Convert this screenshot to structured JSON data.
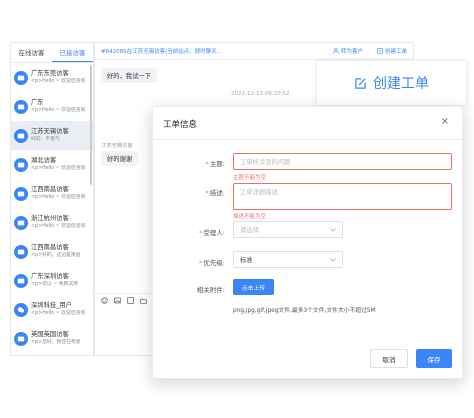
{
  "sidebar": {
    "tabs": [
      "在线访客",
      "已接访客"
    ],
    "items": [
      {
        "name": "广东东莞访客",
        "msg": "<p>Hello ~ 欢迎您咨询"
      },
      {
        "name": "广东",
        "msg": "<p>Hello ~ 欢迎您咨询"
      },
      {
        "name": "江苏无锡访客",
        "msg": "好的，不客气"
      },
      {
        "name": "湖北访客",
        "msg": "<p>Hello ~ 欢迎您咨询"
      },
      {
        "name": "江西南昌访客",
        "msg": "<p>Hello ~ 欢迎您咨询"
      },
      {
        "name": "浙江杭州访客",
        "msg": "<p>Hello ~ 欢迎您咨询"
      },
      {
        "name": "江西南昌访客",
        "msg": "<p>好的，这边是南昌"
      },
      {
        "name": "广东深圳访客",
        "msg": "<p>可以 ~ 免费试用"
      },
      {
        "name": "深圳科技_用户",
        "msg": "<p>Hello ~ 欢迎您咨询"
      },
      {
        "name": "英国英国访客",
        "msg": "<p>您好，我还在考虑"
      }
    ]
  },
  "chat": {
    "title": "#642085在江苏无锡访客(当前站点：即时聊天...",
    "transfer_label": "转为客户",
    "ticket_label": "创建工单",
    "bubble1": "好的，我试一下",
    "timestamp": "2022-12-13 09:20:52",
    "from": "江苏无锡访客",
    "bubble2": "好的谢谢"
  },
  "create_card": {
    "label": "创建工单"
  },
  "modal": {
    "title": "工单信息",
    "close": "×",
    "subject_label": "主题:",
    "subject_placeholder": "工单所涉及的问题",
    "subject_error": "主题不能为空",
    "desc_label": "描述:",
    "desc_placeholder": "工单详细描述",
    "desc_error": "描述不能为空",
    "assignee_label": "受理人:",
    "assignee_placeholder": "请选择",
    "priority_label": "优先级:",
    "priority_value": "标准",
    "attach_label": "相关附件:",
    "upload_label": "点击上传",
    "hint": "png,jpg,gif,jpeg文件,最多3个文件,文件大小不超过5M",
    "cancel_label": "取消",
    "save_label": "保存"
  },
  "colors": {
    "accent": "#3b86f7",
    "error": "#f56c6c"
  }
}
